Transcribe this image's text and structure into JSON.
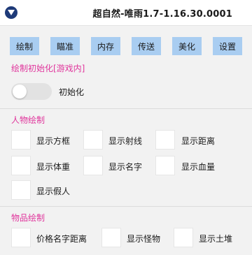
{
  "window": {
    "title": "超自然-唯雨1.7-1.16.30.0001",
    "collapse_icon": "triangle-down-icon"
  },
  "tabs": [
    {
      "label": "绘制"
    },
    {
      "label": "瞄准"
    },
    {
      "label": "内存"
    },
    {
      "label": "传送"
    },
    {
      "label": "美化"
    },
    {
      "label": "设置"
    }
  ],
  "init_section": {
    "title": "绘制初始化[游戏内]",
    "toggle_label": "初始化",
    "toggle_on": false
  },
  "player_section": {
    "title": "人物绘制",
    "options": [
      {
        "label": "显示方框",
        "checked": false
      },
      {
        "label": "显示射线",
        "checked": false
      },
      {
        "label": "显示距离",
        "checked": false
      },
      {
        "label": "显示体重",
        "checked": false
      },
      {
        "label": "显示名字",
        "checked": false
      },
      {
        "label": "显示血量",
        "checked": false
      },
      {
        "label": "显示假人",
        "checked": false
      }
    ]
  },
  "item_section": {
    "title": "物品绘制",
    "options": [
      {
        "label": "价格名字距离",
        "checked": false
      },
      {
        "label": "显示怪物",
        "checked": false
      },
      {
        "label": "显示土堆",
        "checked": false
      }
    ]
  },
  "colors": {
    "accent": "#e0359c",
    "tab_bg": "#a9cdf1",
    "collapse_btn": "#1e3a78"
  }
}
